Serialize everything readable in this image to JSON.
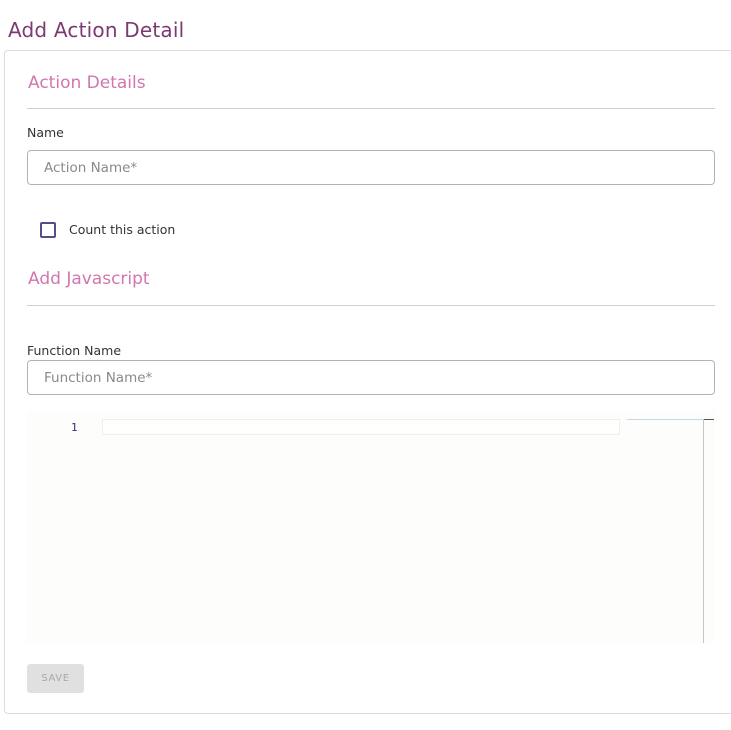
{
  "page": {
    "title": "Add Action Detail"
  },
  "action_details": {
    "section_title": "Action Details",
    "name_label": "Name",
    "name_placeholder": "Action Name*",
    "name_value": "",
    "count_checkbox_label": "Count this action",
    "count_checked": false
  },
  "javascript": {
    "section_title": "Add Javascript",
    "function_label": "Function Name",
    "function_placeholder": "Function Name*",
    "function_value": "",
    "editor": {
      "line_numbers": [
        "1"
      ],
      "code": ""
    }
  },
  "actions": {
    "save_label": "SAVE",
    "save_enabled": false
  },
  "colors": {
    "title": "#7d3a72",
    "section_title": "#d276ae",
    "checkbox_border": "#5a4c8c",
    "button_disabled_bg": "#e0e0e0",
    "button_disabled_text": "#a8a8a8"
  }
}
